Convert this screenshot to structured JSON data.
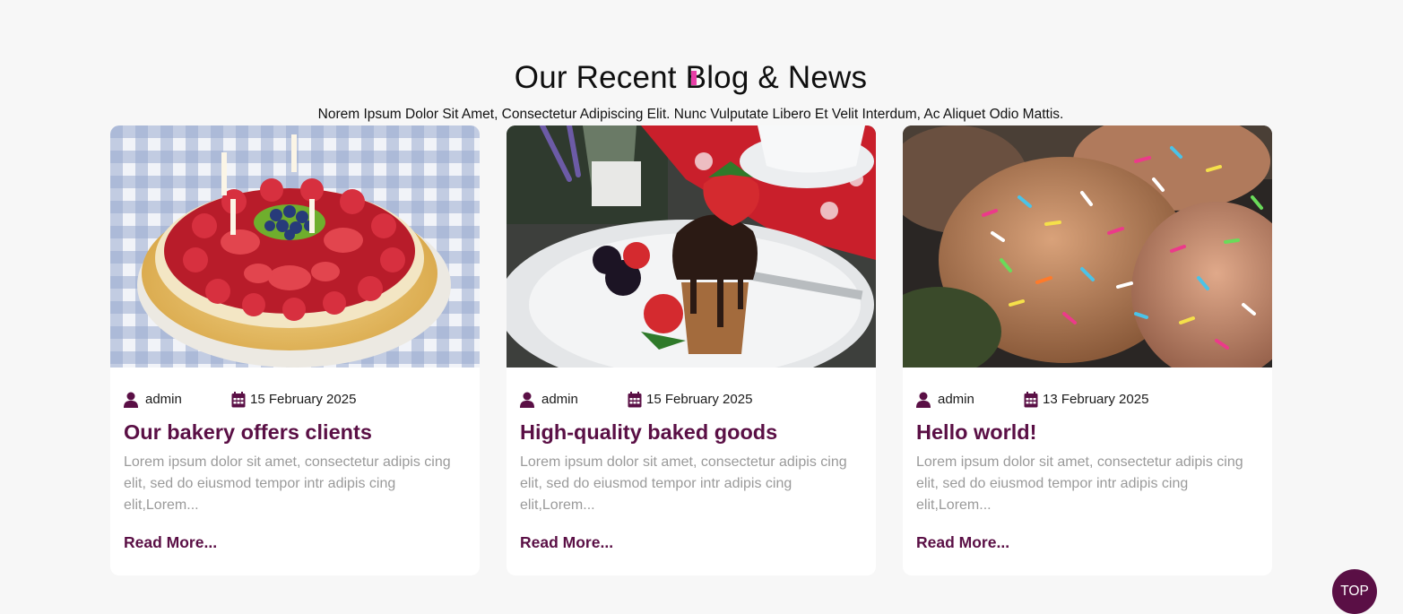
{
  "section": {
    "title": "Our Recent Blog & News",
    "subtitle": "Norem Ipsum Dolor Sit Amet, Consectetur Adipiscing Elit. Nunc Vulputate Libero Et Velit Interdum, Ac Aliquet Odio Mattis."
  },
  "colors": {
    "accent_bar": "#e83ea7",
    "brand": "#5a0f45",
    "excerpt_text": "#9a9a9a",
    "background": "#f7f7f7"
  },
  "posts": [
    {
      "image": "fruit-tart-photo",
      "author": "admin",
      "date": "15 February 2025",
      "title": "Our bakery offers clients",
      "excerpt": "Lorem ipsum dolor sit amet, consectetur adipis cing elit, sed do eiusmod tempor intr adipis cing elit,Lorem...",
      "read_more": "Read More..."
    },
    {
      "image": "chocolate-muffin-photo",
      "author": "admin",
      "date": "15 February 2025",
      "title": "High-quality baked goods",
      "excerpt": "Lorem ipsum dolor sit amet, consectetur adipis cing elit, sed do eiusmod tempor intr adipis cing elit,Lorem...",
      "read_more": "Read More..."
    },
    {
      "image": "sprinkle-muffins-photo",
      "author": "admin",
      "date": "13 February 2025",
      "title": "Hello world!",
      "excerpt": "Lorem ipsum dolor sit amet, consectetur adipis cing elit, sed do eiusmod tempor intr adipis cing elit,Lorem...",
      "read_more": "Read More..."
    }
  ],
  "icons": {
    "author": "user-icon",
    "date": "calendar-icon"
  },
  "top_button": {
    "label": "TOP"
  }
}
